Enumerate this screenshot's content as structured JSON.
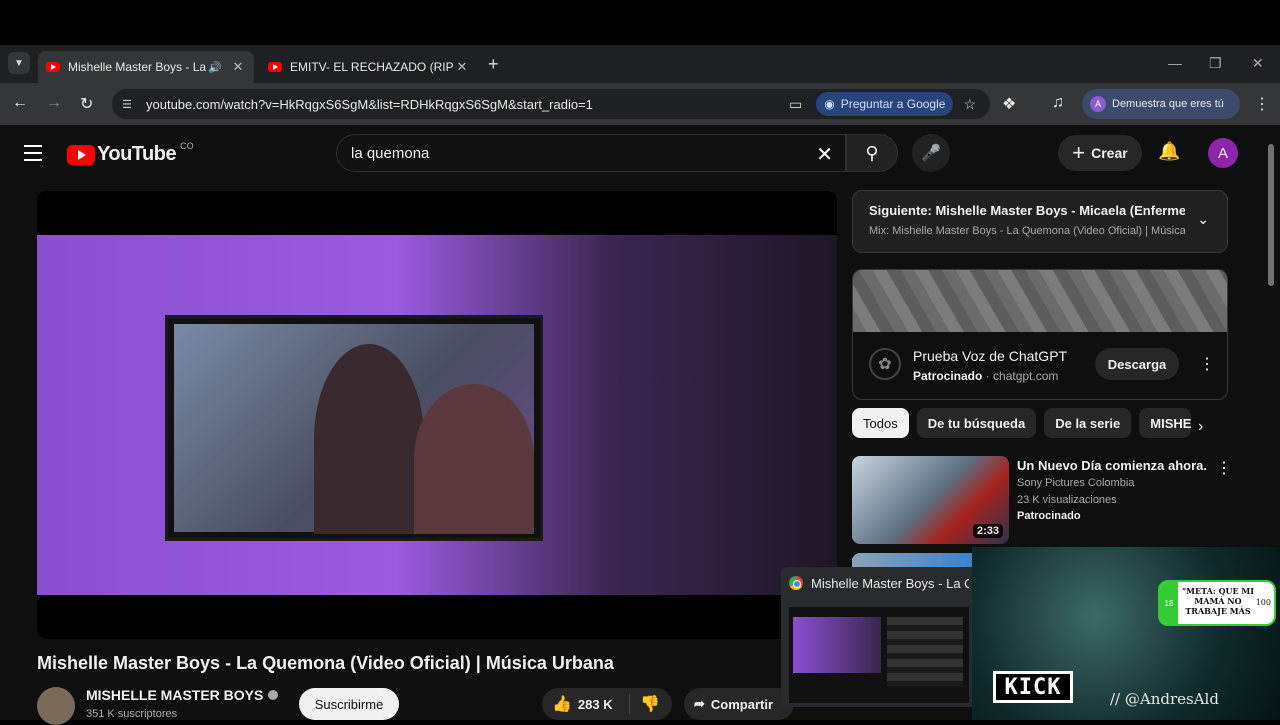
{
  "browser": {
    "tabs": [
      {
        "title": "Mishelle Master Boys - La Quemona",
        "active": true
      },
      {
        "title": "EMITV- EL RECHAZADO (RIP JUAN)",
        "active": false
      }
    ],
    "url": "youtube.com/watch?v=HkRqgxS6SgM&list=RDHkRqgxS6SgM&start_radio=1",
    "ask_google": "Preguntar a Google",
    "profile_label": "Demuestra que eres tú",
    "profile_initial": "A"
  },
  "youtube": {
    "logo_text": "YouTube",
    "country_code": "CO",
    "search_value": "la quemona",
    "create_label": "Crear",
    "avatar_initial": "A",
    "video": {
      "title": "Mishelle Master Boys - La Quemona (Video Oficial) | Música Urbana",
      "channel": "MISHELLE MASTER BOYS",
      "subscribers": "351 K suscriptores",
      "subscribe_label": "Suscribirme",
      "likes": "283 K",
      "share_label": "Compartir"
    },
    "playlist": {
      "next": "Siguiente: Mishelle Master Boys - Micaela (Enfermera)",
      "mix": "Mix: Mishelle Master Boys - La Quemona (Video Oficial) | Música Urbana"
    },
    "ad": {
      "title": "Prueba Voz de ChatGPT",
      "sponsored": "Patrocinado",
      "domain": "chatgpt.com",
      "button": "Descarga"
    },
    "chips": [
      "Todos",
      "De tu búsqueda",
      "De la serie",
      "MISHELLE MASTER BOYS"
    ],
    "recommendations": [
      {
        "title": "Un Nuevo Día comienza ahora.",
        "channel": "Sony Pictures Colombia",
        "views": "23 K visualizaciones",
        "tag": "Patrocinado",
        "duration": "2:33"
      }
    ]
  },
  "overlay": {
    "popup_title": "Mishelle Master Boys - La Quemona",
    "card_text": "\"META: QUE MI MAMÁ NO TRABAJE MÁS",
    "card_left": "18",
    "card_right": "100",
    "kick": "KICK",
    "handle": "// @AndresAld"
  }
}
